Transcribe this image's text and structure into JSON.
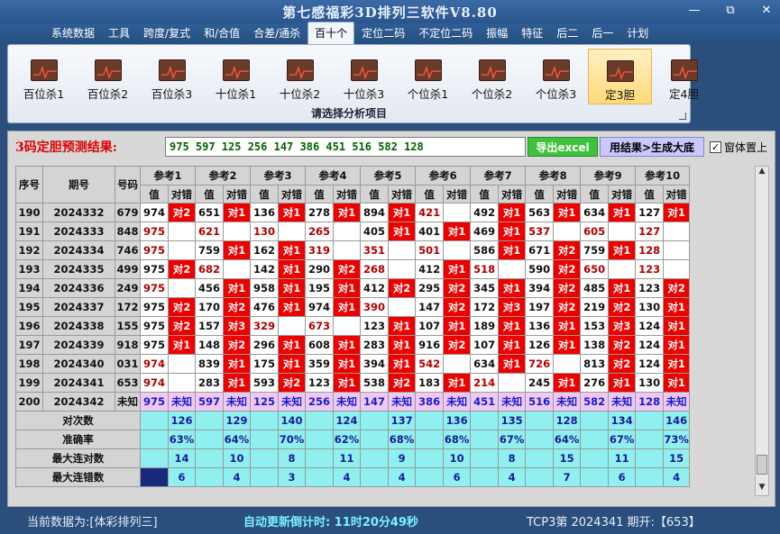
{
  "window": {
    "title": "第七感福彩3D排列三软件V8.80",
    "min": "—",
    "max": "⧉",
    "close": "✕"
  },
  "menu": [
    "系统数据",
    "工具",
    "跨度/复式",
    "和/合值",
    "合差/通杀",
    "百十个",
    "定位二码",
    "不定位二码",
    "振幅",
    "特征",
    "后二",
    "后一",
    "计划"
  ],
  "menu_active": 5,
  "ribbon": {
    "items": [
      "百位杀1",
      "百位杀2",
      "百位杀3",
      "十位杀1",
      "十位杀2",
      "十位杀3",
      "个位杀1",
      "个位杀2",
      "个位杀3",
      "定3胆",
      "定4胆"
    ],
    "active": 9,
    "caption": "请选择分析项目"
  },
  "predict": {
    "label": "3码定胆预测结果:",
    "value": "975 597 125 256 147 386 451 516 582 128",
    "export_label": "导出excel",
    "bigbase_label": "用结果>生成大底",
    "ontop_label": "窗体置上",
    "ontop_checked": "✓"
  },
  "table": {
    "h_seq": "序号",
    "h_period": "期号",
    "h_code": "号码",
    "refs": [
      "参考1",
      "参考2",
      "参考3",
      "参考4",
      "参考5",
      "参考6",
      "参考7",
      "参考8",
      "参考9",
      "参考10"
    ],
    "sub_val": "值",
    "sub_res": "对错",
    "rows": [
      {
        "seq": "190",
        "period": "2024332",
        "code": "679",
        "cells": [
          [
            "974",
            "对2"
          ],
          [
            "651",
            "对1"
          ],
          [
            "136",
            "对1"
          ],
          [
            "278",
            "对1"
          ],
          [
            "894",
            "对1"
          ],
          [
            "421",
            ""
          ],
          [
            "492",
            "对1"
          ],
          [
            "563",
            "对1"
          ],
          [
            "634",
            "对1"
          ],
          [
            "127",
            "对1"
          ]
        ]
      },
      {
        "seq": "191",
        "period": "2024333",
        "code": "848",
        "cells": [
          [
            "975",
            ""
          ],
          [
            "621",
            ""
          ],
          [
            "130",
            ""
          ],
          [
            "265",
            ""
          ],
          [
            "405",
            "对1"
          ],
          [
            "401",
            "对1"
          ],
          [
            "469",
            "对1"
          ],
          [
            "537",
            ""
          ],
          [
            "605",
            ""
          ],
          [
            "127",
            ""
          ]
        ]
      },
      {
        "seq": "192",
        "period": "2024334",
        "code": "746",
        "cells": [
          [
            "975",
            ""
          ],
          [
            "759",
            "对1"
          ],
          [
            "162",
            "对1"
          ],
          [
            "319",
            ""
          ],
          [
            "351",
            ""
          ],
          [
            "501",
            ""
          ],
          [
            "586",
            "对1"
          ],
          [
            "671",
            "对2"
          ],
          [
            "759",
            "对1"
          ],
          [
            "128",
            ""
          ]
        ]
      },
      {
        "seq": "193",
        "period": "2024335",
        "code": "499",
        "cells": [
          [
            "975",
            "对2"
          ],
          [
            "682",
            ""
          ],
          [
            "142",
            "对1"
          ],
          [
            "290",
            "对2"
          ],
          [
            "268",
            ""
          ],
          [
            "412",
            "对1"
          ],
          [
            "518",
            ""
          ],
          [
            "590",
            "对2"
          ],
          [
            "650",
            ""
          ],
          [
            "123",
            ""
          ]
        ]
      },
      {
        "seq": "194",
        "period": "2024336",
        "code": "249",
        "cells": [
          [
            "975",
            ""
          ],
          [
            "456",
            "对1"
          ],
          [
            "958",
            "对1"
          ],
          [
            "195",
            "对1"
          ],
          [
            "412",
            "对2"
          ],
          [
            "295",
            "对2"
          ],
          [
            "345",
            "对1"
          ],
          [
            "394",
            "对2"
          ],
          [
            "485",
            "对1"
          ],
          [
            "123",
            "对2"
          ]
        ]
      },
      {
        "seq": "195",
        "period": "2024337",
        "code": "172",
        "cells": [
          [
            "975",
            "对2"
          ],
          [
            "170",
            "对2"
          ],
          [
            "476",
            "对1"
          ],
          [
            "974",
            "对1"
          ],
          [
            "390",
            ""
          ],
          [
            "147",
            "对2"
          ],
          [
            "172",
            "对3"
          ],
          [
            "197",
            "对2"
          ],
          [
            "219",
            "对2"
          ],
          [
            "130",
            "对1"
          ]
        ]
      },
      {
        "seq": "196",
        "period": "2024338",
        "code": "155",
        "cells": [
          [
            "975",
            "对2"
          ],
          [
            "157",
            "对3"
          ],
          [
            "329",
            ""
          ],
          [
            "673",
            ""
          ],
          [
            "123",
            "对1"
          ],
          [
            "107",
            "对1"
          ],
          [
            "189",
            "对1"
          ],
          [
            "136",
            "对1"
          ],
          [
            "153",
            "对3"
          ],
          [
            "124",
            "对1"
          ]
        ]
      },
      {
        "seq": "197",
        "period": "2024339",
        "code": "918",
        "cells": [
          [
            "975",
            "对1"
          ],
          [
            "148",
            "对2"
          ],
          [
            "296",
            "对1"
          ],
          [
            "608",
            "对1"
          ],
          [
            "283",
            "对1"
          ],
          [
            "916",
            "对2"
          ],
          [
            "107",
            "对1"
          ],
          [
            "126",
            "对1"
          ],
          [
            "138",
            "对2"
          ],
          [
            "124",
            "对1"
          ]
        ]
      },
      {
        "seq": "198",
        "period": "2024340",
        "code": "031",
        "cells": [
          [
            "974",
            ""
          ],
          [
            "839",
            "对1"
          ],
          [
            "175",
            "对1"
          ],
          [
            "359",
            "对1"
          ],
          [
            "394",
            "对1"
          ],
          [
            "542",
            ""
          ],
          [
            "634",
            "对1"
          ],
          [
            "726",
            ""
          ],
          [
            "813",
            "对2"
          ],
          [
            "124",
            "对1"
          ]
        ]
      },
      {
        "seq": "199",
        "period": "2024341",
        "code": "653",
        "cells": [
          [
            "974",
            ""
          ],
          [
            "283",
            "对1"
          ],
          [
            "593",
            "对2"
          ],
          [
            "123",
            "对1"
          ],
          [
            "538",
            "对2"
          ],
          [
            "183",
            "对1"
          ],
          [
            "214",
            ""
          ],
          [
            "245",
            "对1"
          ],
          [
            "276",
            "对1"
          ],
          [
            "130",
            "对1"
          ]
        ]
      }
    ],
    "pred_row": {
      "seq": "200",
      "period": "2024342",
      "code": "未知",
      "cells": [
        [
          "975",
          "未知"
        ],
        [
          "597",
          "未知"
        ],
        [
          "125",
          "未知"
        ],
        [
          "256",
          "未知"
        ],
        [
          "147",
          "未知"
        ],
        [
          "386",
          "未知"
        ],
        [
          "451",
          "未知"
        ],
        [
          "516",
          "未知"
        ],
        [
          "582",
          "未知"
        ],
        [
          "128",
          "未知"
        ]
      ]
    },
    "stats": [
      {
        "label": "对次数",
        "values": [
          "126",
          "129",
          "140",
          "124",
          "137",
          "136",
          "135",
          "128",
          "134",
          "146"
        ]
      },
      {
        "label": "准确率",
        "values": [
          "63%",
          "64%",
          "70%",
          "62%",
          "68%",
          "68%",
          "67%",
          "64%",
          "67%",
          "73%"
        ]
      },
      {
        "label": "最大连对数",
        "values": [
          "14",
          "10",
          "8",
          "11",
          "9",
          "10",
          "8",
          "15",
          "11",
          "15"
        ]
      },
      {
        "label": "最大连错数",
        "values": [
          "6",
          "4",
          "3",
          "4",
          "4",
          "6",
          "4",
          "7",
          "6",
          "4"
        ]
      }
    ]
  },
  "status": {
    "source": "当前数据为:[体彩排列三]",
    "countdown": "自动更新倒计时: 11时20分49秒",
    "period": "TCP3第 2024341 期开:【653】"
  },
  "colors": {
    "red_cell": "#ee0000",
    "pred_row": "#f0c8f4",
    "stat_row": "#8ff0ef"
  }
}
